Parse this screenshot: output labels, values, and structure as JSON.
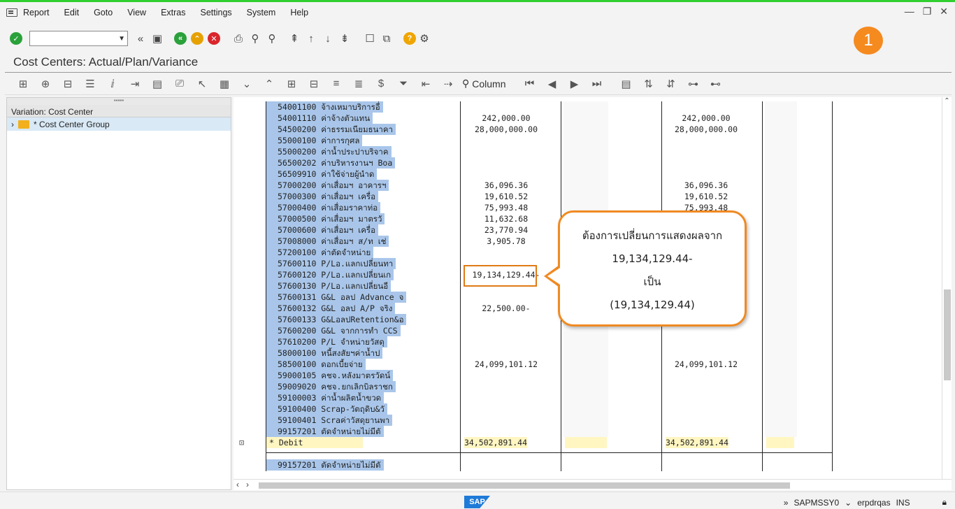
{
  "menu": {
    "items": [
      "Report",
      "Edit",
      "Goto",
      "View",
      "Extras",
      "Settings",
      "System",
      "Help"
    ]
  },
  "title": "Cost Centers: Actual/Plan/Variance",
  "badge": "1",
  "toolbar": {
    "column_label": "Column"
  },
  "tree": {
    "header": "Variation: Cost Center",
    "node": "* Cost Center Group"
  },
  "report": {
    "rows": [
      {
        "acct": "54001100  จ้างเหมาบริการอื่",
        "actual": "",
        "plan": ""
      },
      {
        "acct": "54001110  ค่าจ้างตัวแทน",
        "actual": "242,000.00",
        "plan": "242,000.00"
      },
      {
        "acct": "54500200  ค่าธรรมเนียมธนาคา",
        "actual": "28,000,000.00",
        "plan": "28,000,000.00"
      },
      {
        "acct": "55000100  ค่าการกุศล",
        "actual": "",
        "plan": ""
      },
      {
        "acct": "55000200  ค่าน้ำประปาบริจาค",
        "actual": "",
        "plan": ""
      },
      {
        "acct": "56500202  ค่าบริหารงานฯ Boa",
        "actual": "",
        "plan": ""
      },
      {
        "acct": "56509910  ค่าใช้จ่ายผู้นำด",
        "actual": "",
        "plan": ""
      },
      {
        "acct": "57000200  ค่าเสื่อมฯ อาคารฯ",
        "actual": "36,096.36",
        "plan": "36,096.36"
      },
      {
        "acct": "57000300  ค่าเสื่อมฯ เครื่อ",
        "actual": "19,610.52",
        "plan": "19,610.52"
      },
      {
        "acct": "57000400  ค่าเสื่อมราคาท่อ",
        "actual": "75,993.48",
        "plan": "75,993.48"
      },
      {
        "acct": "57000500  ค่าเสื่อมฯ มาตรวั",
        "actual": "11,632.68",
        "plan": ""
      },
      {
        "acct": "57000600  ค่าเสื่อมฯ เครื่อ",
        "actual": "23,770.94",
        "plan": ""
      },
      {
        "acct": "57008000  ค่าเสื่อมฯ ส/ท เช่",
        "actual": "3,905.78",
        "plan": ""
      },
      {
        "acct": "57200100  ค่าตัดจำหน่าย",
        "actual": "",
        "plan": ""
      },
      {
        "acct": "57600110  P/Lอ.แลกเปลี่ยนทา",
        "actual": "",
        "plan": ""
      },
      {
        "acct": "57600120  P/Lอ.แลกเปลี่ยนเก",
        "actual": "19,134,129.44-",
        "plan": ""
      },
      {
        "acct": "57600130  P/Lอ.แลกเปลี่ยนอี",
        "actual": "",
        "plan": ""
      },
      {
        "acct": "57600131  G&L อลป Advance จ",
        "actual": "",
        "plan": ""
      },
      {
        "acct": "57600132  G&L อลป A/P จริง",
        "actual": "22,500.00-",
        "plan": ""
      },
      {
        "acct": "57600133  G&LอลปRetention&อ",
        "actual": "",
        "plan": ""
      },
      {
        "acct": "57600200  G&L จากการทำ CCS",
        "actual": "",
        "plan": ""
      },
      {
        "acct": "57610200  P/L จำหน่ายวัสดุ",
        "actual": "",
        "plan": ""
      },
      {
        "acct": "58000100  หนี้สงสัยฯค่าน้ำป",
        "actual": "",
        "plan": ""
      },
      {
        "acct": "58500100  ดอกเบี้ยจ่าย",
        "actual": "24,099,101.12",
        "plan": "24,099,101.12"
      },
      {
        "acct": "59000105  คชจ.หลังมาตรวัดน์",
        "actual": "",
        "plan": ""
      },
      {
        "acct": "59009020  คชจ.ยกเลิกบิลราชก",
        "actual": "",
        "plan": ""
      },
      {
        "acct": "59100003  ค่าน้ำผลิตน้ำขวด",
        "actual": "",
        "plan": ""
      },
      {
        "acct": "59100400  Scrap-วัตถุดิบ&วั",
        "actual": "",
        "plan": ""
      },
      {
        "acct": "59100401  Scraค่าวัสดุยานพา",
        "actual": "",
        "plan": ""
      },
      {
        "acct": "99157201  ตัดจำหน่ายไม่มีตั",
        "actual": "",
        "plan": ""
      }
    ],
    "total": {
      "label": "*  Debit",
      "actual": "34,502,891.44",
      "plan": "34,502,891.44"
    },
    "after_row": {
      "acct": "99157201  ตัดจำหน่ายไม่มีตั"
    }
  },
  "callout": {
    "line1": "ต้องการเปลี่ยนการแสดงผลจาก",
    "line2": "19,134,129.44-",
    "line3": "เป็น",
    "line4": "(19,134,129.44)"
  },
  "status": {
    "system": "SAPMSSY0",
    "server": "erpdrqas",
    "mode": "INS"
  },
  "colors": {
    "accent": "#f58a1f",
    "selection": "#a9c6ea",
    "total": "#fff6c2",
    "topbar": "#2fcf2f"
  }
}
